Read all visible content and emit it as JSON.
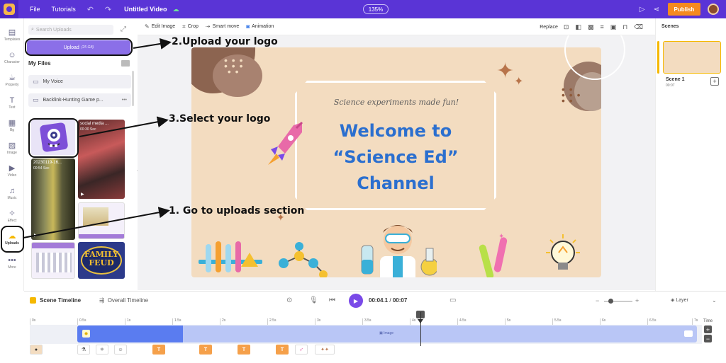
{
  "topbar": {
    "file": "File",
    "tutorials": "Tutorials",
    "title": "Untitled Video",
    "zoom": "135%",
    "publish": "Publish"
  },
  "lefttools": [
    {
      "label": "Templates",
      "icon": "templates-icon",
      "glyph": "▤"
    },
    {
      "label": "Character",
      "icon": "character-icon",
      "glyph": "☺"
    },
    {
      "label": "Property",
      "icon": "property-icon",
      "glyph": "☕"
    },
    {
      "label": "Text",
      "icon": "text-icon",
      "glyph": "T"
    },
    {
      "label": "Bg",
      "icon": "background-icon",
      "glyph": "▦"
    },
    {
      "label": "Image",
      "icon": "image-icon",
      "glyph": "▨"
    },
    {
      "label": "Video",
      "icon": "video-icon",
      "glyph": "▶"
    },
    {
      "label": "Music",
      "icon": "music-icon",
      "glyph": "♫"
    },
    {
      "label": "Effect",
      "icon": "effect-icon",
      "glyph": "✧"
    },
    {
      "label": "Uploads",
      "icon": "uploads-icon",
      "glyph": "☁"
    },
    {
      "label": "More",
      "icon": "more-icon",
      "glyph": "•••"
    }
  ],
  "panel": {
    "search_placeholder": "Search Uploads",
    "upload_label": "Upload",
    "upload_size": "(25 GB)",
    "my_files": "My Files",
    "folders": [
      "My Voice",
      "Backlink-Hunting Game p..."
    ],
    "thumbs": [
      {
        "title": "",
        "duration": ""
      },
      {
        "title": "social media ...",
        "duration": "00:30 Sec"
      },
      {
        "title": "20230119-16...",
        "duration": "00:54 Sec"
      }
    ],
    "family_feud": {
      "line1": "FAMILY",
      "line2": "FEUD"
    }
  },
  "edittools": {
    "edit_image": "Edit Image",
    "crop": "Crop",
    "smart_move": "Smart move",
    "animation": "Animation",
    "replace": "Replace"
  },
  "slide": {
    "subtitle": "Science experiments made fun!",
    "headline_1": "Welcome to",
    "headline_2": "“Science Ed”",
    "headline_3": "Channel"
  },
  "scenes": {
    "header": "Scenes",
    "scene_name": "Scene 1",
    "scene_duration": "00:07"
  },
  "timeline": {
    "scene_timeline": "Scene Timeline",
    "overall_timeline": "Overall Timeline",
    "current_time": "00:04.1",
    "separator": " / ",
    "total_time": "00:07",
    "layer": "Layer",
    "time_label": "Time",
    "image_label": "Image",
    "ticks": [
      "0s",
      "0.5s",
      "1s",
      "1.5s",
      "2s",
      "2.5s",
      "3s",
      "3.5s",
      "4s",
      "4.5s",
      "5s",
      "5.5s",
      "6s",
      "6.5s",
      "7s"
    ]
  },
  "annotations": {
    "upload_logo": "2.Upload your logo",
    "select_logo": "3.Select your logo",
    "go_uploads": "1. Go to uploads section"
  },
  "colors": {
    "topbar": "#5a34d6",
    "publish": "#f58a1f",
    "upload_button": "#8b6fe8",
    "headline": "#2b6fcf",
    "slide_bg": "#f3dcc0",
    "accent": "#f5b800"
  }
}
